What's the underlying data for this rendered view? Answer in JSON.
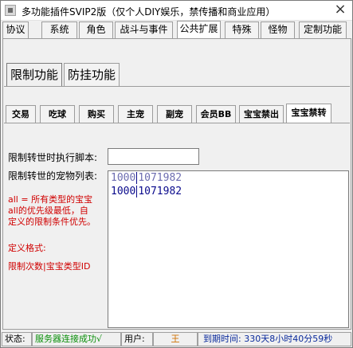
{
  "window": {
    "title": "多功能插件SVIP2版（仅个人DIY娱乐，禁传播和商业应用）",
    "close_glyph": "×"
  },
  "main_tabs": [
    "协议",
    "系统",
    "角色",
    "战斗与事件",
    "公共扩展",
    "特殊",
    "怪物",
    "定制功能"
  ],
  "section_tabs": [
    "限制功能",
    "防挂功能"
  ],
  "sub_tabs": [
    "交易",
    "吃球",
    "购买",
    "主宠",
    "副宠",
    "会员BB",
    "宝宝禁出",
    "宝宝禁转"
  ],
  "form": {
    "script_label": "限制转世时执行脚本:",
    "script_value": "",
    "list_label": "限制转世的宠物列表:"
  },
  "list_rows": [
    {
      "count": "1000",
      "id": "1071982"
    },
    {
      "count": "1000",
      "id": "1071982"
    }
  ],
  "notes": {
    "line1": "all = 所有类型的宝宝",
    "line2": "all的优先级最低，自",
    "line3": "定义的限制条件优先。",
    "format_title": "定义格式:",
    "format_value": "限制次数|宝宝类型ID"
  },
  "status": {
    "state_label": "状态:",
    "state_value": "服务器连接成功√",
    "user_label": "用户:",
    "user_value": "王",
    "expiry": "到期时间: 330天8小时40分59秒"
  },
  "colors": {
    "status_ok": "#0a8f0a",
    "user": "#d07000",
    "expiry": "#0a2a9c",
    "note_red": "#d00000",
    "list_blue": "#0a0a8c"
  }
}
